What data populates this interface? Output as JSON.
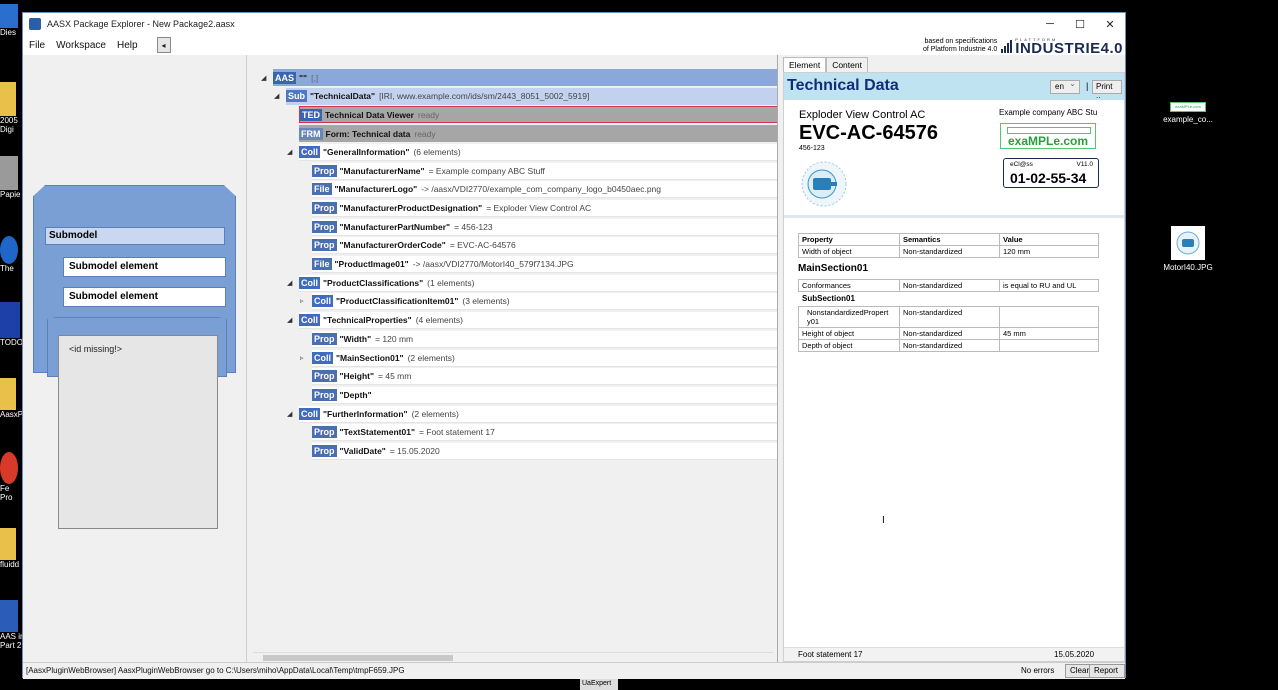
{
  "window": {
    "title": "AASX Package Explorer - New Package2.aasx",
    "controls": {
      "minimize": "─",
      "maximize": "☐",
      "close": "✕"
    }
  },
  "menubar": {
    "items": [
      "File",
      "Workspace",
      "Help"
    ],
    "collapse": "◂"
  },
  "brand": {
    "spec_line1": "based on specifications",
    "spec_line2": "of Platform Industrie 4.0",
    "platform": "PLATTFORM",
    "logo": "INDUSTRIE4.0"
  },
  "left": {
    "submodel_label": "Submodel",
    "elements": [
      "Submodel element",
      "Submodel element"
    ],
    "id_missing": "<id missing!>"
  },
  "tree": [
    {
      "badge": "AAS",
      "name": "\"\"",
      "info": "[,]",
      "style": "aas"
    },
    {
      "badge": "Sub",
      "name": "\"TechnicalData\"",
      "info": "[IRI, www.example.com/ids/sm/2443_8051_5002_5919]",
      "style": "sub"
    },
    {
      "badge": "TED",
      "name": "Technical Data Viewer",
      "info": "ready",
      "style": "ted"
    },
    {
      "badge": "FRM",
      "name": "Form: Technical data",
      "info": "ready",
      "style": "frm"
    },
    {
      "badge": "Coll",
      "name": "\"GeneralInformation\"",
      "info": "(6 elements)"
    },
    {
      "badge": "Prop",
      "name": "\"ManufacturerName\"",
      "info": "= Example company ABC Stuff"
    },
    {
      "badge": "File",
      "name": "\"ManufacturerLogo\"",
      "info": "-> /aasx/VDI2770/example_com_company_logo_b0450aec.png"
    },
    {
      "badge": "Prop",
      "name": "\"ManufacturerProductDesignation\"",
      "info": "= Exploder View Control AC"
    },
    {
      "badge": "Prop",
      "name": "\"ManufacturerPartNumber\"",
      "info": "= 456-123"
    },
    {
      "badge": "Prop",
      "name": "\"ManufacturerOrderCode\"",
      "info": "= EVC-AC-64576"
    },
    {
      "badge": "File",
      "name": "\"ProductImage01\"",
      "info": "-> /aasx/VDI2770/MotorI40_579f7134.JPG"
    },
    {
      "badge": "Coll",
      "name": "\"ProductClassifications\"",
      "info": "(1 elements)"
    },
    {
      "badge": "Coll",
      "name": "\"ProductClassificationItem01\"",
      "info": "(3 elements)"
    },
    {
      "badge": "Coll",
      "name": "\"TechnicalProperties\"",
      "info": "(4 elements)"
    },
    {
      "badge": "Prop",
      "name": "\"Width\"",
      "info": "= 120 mm"
    },
    {
      "badge": "Coll",
      "name": "\"MainSection01\"",
      "info": "(2 elements)"
    },
    {
      "badge": "Prop",
      "name": "\"Height\"",
      "info": "= 45 mm"
    },
    {
      "badge": "Prop",
      "name": "\"Depth\"",
      "info": ""
    },
    {
      "badge": "Coll",
      "name": "\"FurtherInformation\"",
      "info": "(2 elements)"
    },
    {
      "badge": "Prop",
      "name": "\"TextStatement01\"",
      "info": "= Foot statement 17"
    },
    {
      "badge": "Prop",
      "name": "\"ValidDate\"",
      "info": "= 15.05.2020"
    }
  ],
  "right": {
    "tabs": [
      "Element",
      "Content"
    ],
    "title": "Technical Data",
    "lang": "en",
    "print": "Print ..",
    "pipe": "|",
    "product_name": "Exploder View Control AC",
    "product_code": "EVC-AC-64576",
    "part_number": "456-123",
    "manufacturer": "Example company ABC Stu",
    "logo_text": "exaMPLe.com",
    "eclass_label": "eCl@ss",
    "eclass_version": "V11.0",
    "eclass_code": "01-02-55-34",
    "table1": {
      "headers": [
        "Property",
        "Semantics",
        "Value"
      ],
      "rows": [
        [
          "Width of object",
          "Non-standardized",
          "120 mm"
        ]
      ]
    },
    "main_section": "MainSection01",
    "table2": {
      "rows": [
        [
          "Conformances",
          "Non-standardized",
          "is equal to RU and UL"
        ]
      ]
    },
    "sub_section": "SubSection01",
    "table3": {
      "rows": [
        [
          "NonstandardizedPropert y01",
          "Non-standardized",
          ""
        ],
        [
          "Height of object",
          "Non-standardized",
          "45 mm"
        ],
        [
          "Depth of object",
          "Non-standardized",
          ""
        ]
      ]
    },
    "footer_left": "Foot statement 17",
    "footer_right": "15.05.2020"
  },
  "status": {
    "message": "[AasxPluginWebBrowser] AasxPluginWebBrowser go to C:\\Users\\miho\\AppData\\Local\\Temp\\tmpF659.JPG",
    "errors": "No errors",
    "clear": "Clear",
    "report": "Report .."
  },
  "desktop": {
    "left_labels": [
      "Dies",
      "2005",
      "Digi",
      "Papie",
      "The",
      "TODO",
      "AasxP",
      "Fe",
      "Pro",
      "fluidd",
      "AAS ir",
      "Part 2"
    ],
    "right_icons": [
      "example_co...",
      "MotorI40.JPG"
    ],
    "right_icon_text": "exaMPLe.com",
    "taskbar_label": "UaExpert"
  },
  "colors": {
    "prop": "#4a6fb0",
    "coll": "#3f6cbf",
    "file": "#4a6fb0",
    "ted": "#3a64ad",
    "frm": "#6a86b8"
  }
}
